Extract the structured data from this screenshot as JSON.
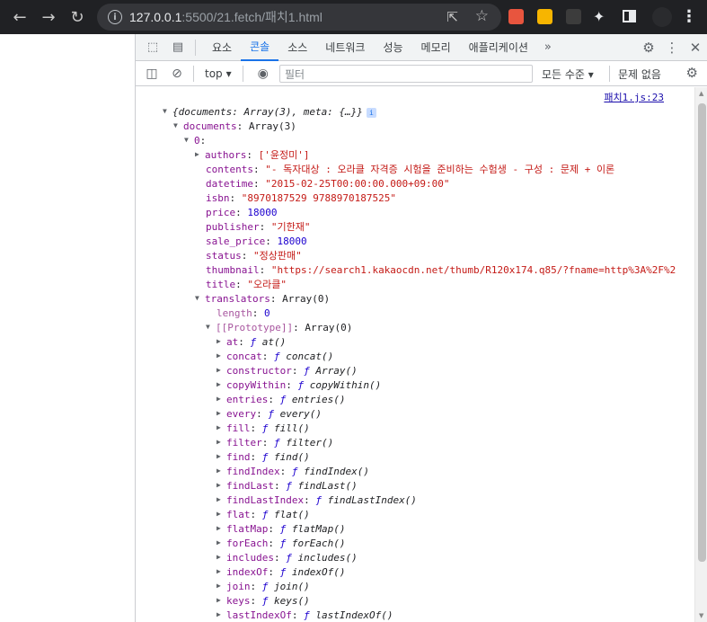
{
  "browser": {
    "url_host": "127.0.0.1",
    "url_rest": ":5500/21.fetch/패치1.html",
    "back_icon": "arrow-left-icon",
    "forward_icon": "arrow-right-icon",
    "reload_icon": "reload-icon"
  },
  "devtools": {
    "tabs": [
      "요소",
      "콘솔",
      "소스",
      "네트워크",
      "성능",
      "메모리",
      "애플리케이션"
    ],
    "active_tab": "콘솔",
    "more_tabs": "»",
    "context": "top",
    "filter_placeholder": "필터",
    "levels": "모든 수준 ▾",
    "issues": "문제 없음",
    "accent": "#1a73e8"
  },
  "console": {
    "source_link": "패치1.js:23",
    "root_summary": "{documents: Array(3), meta: {…}}",
    "documents_key": "documents",
    "documents_val": "Array(3)",
    "index_key": "0",
    "authors_key": "authors",
    "authors_val": "['윤정미']",
    "contents_key": "contents",
    "contents_val": "\"- 독자대상 : 오라클 자격증 시험을 준비하는 수험생  - 구성 : 문제 + 이론",
    "datetime_key": "datetime",
    "datetime_val": "\"2015-02-25T00:00:00.000+09:00\"",
    "isbn_key": "isbn",
    "isbn_val": "\"8970187529 9788970187525\"",
    "price_key": "price",
    "price_val": "18000",
    "publisher_key": "publisher",
    "publisher_val": "\"기한재\"",
    "sale_price_key": "sale_price",
    "sale_price_val": "18000",
    "status_key": "status",
    "status_val": "\"정상판매\"",
    "thumbnail_key": "thumbnail",
    "thumbnail_val": "\"https://search1.kakaocdn.net/thumb/R120x174.q85/?fname=http%3A%2F%2",
    "title_key": "title",
    "title_val": "\"오라클\"",
    "translators_key": "translators",
    "translators_val": "Array(0)",
    "length_key": "length",
    "length_val": "0",
    "prototype_key": "[[Prototype]]",
    "prototype_val": "Array(0)",
    "methods": [
      "at",
      "concat",
      "constructor",
      "copyWithin",
      "entries",
      "every",
      "fill",
      "filter",
      "find",
      "findIndex",
      "findLast",
      "findLastIndex",
      "flat",
      "flatMap",
      "forEach",
      "includes",
      "indexOf",
      "join",
      "keys",
      "lastIndexOf"
    ],
    "method_values": [
      "at()",
      "concat()",
      "Array()",
      "copyWithin()",
      "entries()",
      "every()",
      "fill()",
      "filter()",
      "find()",
      "findIndex()",
      "findLast()",
      "findLastIndex()",
      "flat()",
      "flatMap()",
      "forEach()",
      "includes()",
      "indexOf()",
      "join()",
      "keys()",
      "lastIndexOf()"
    ]
  }
}
